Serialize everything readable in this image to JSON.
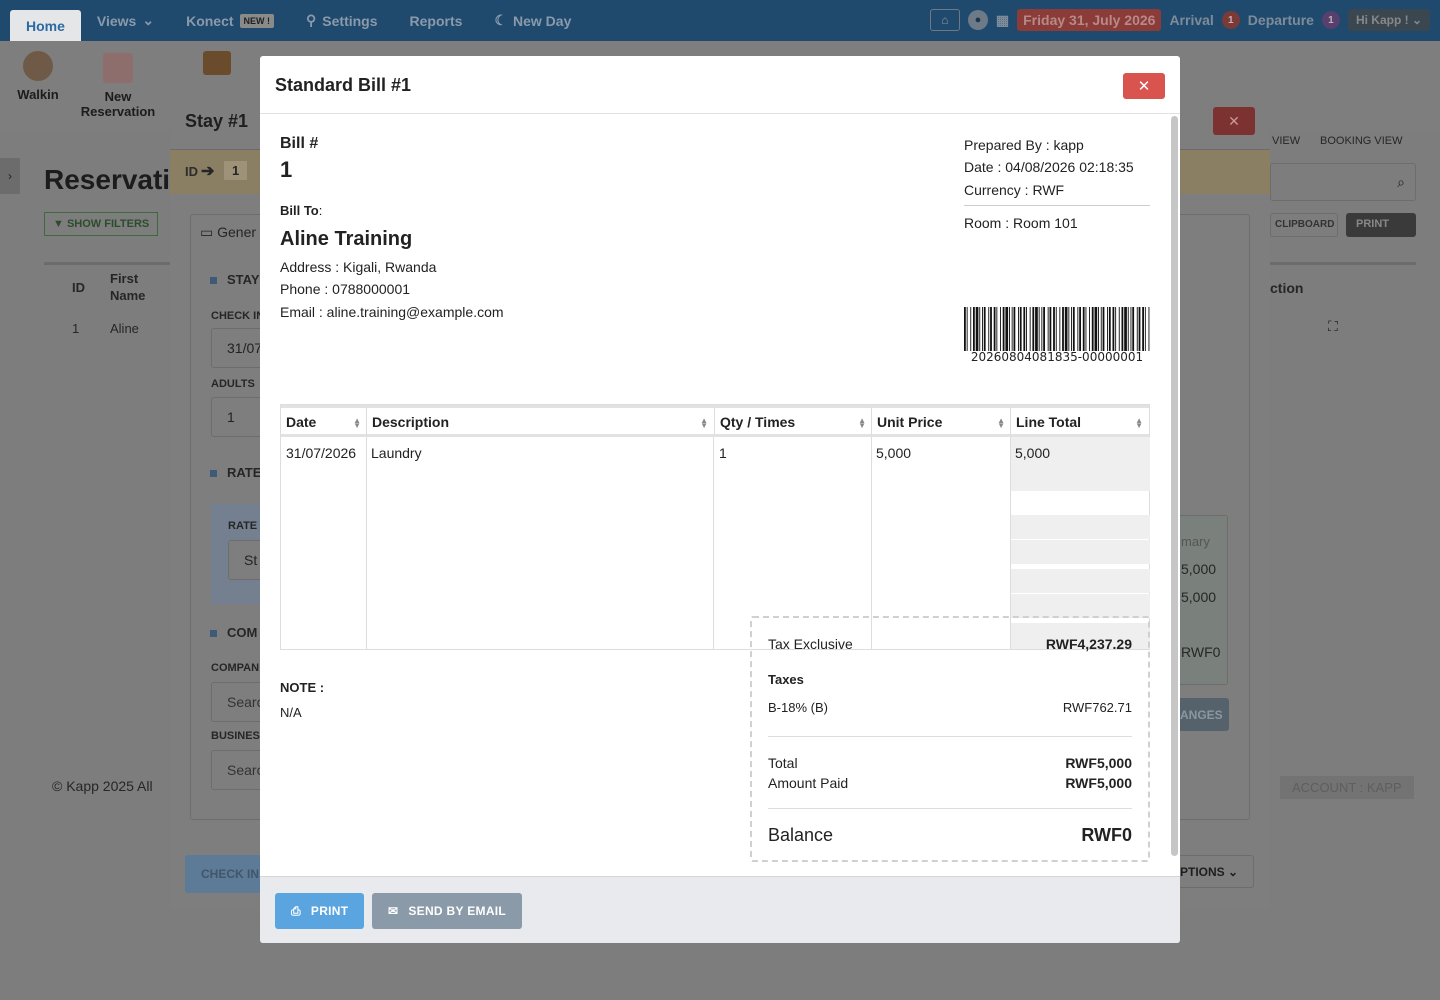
{
  "nav": {
    "tabs": [
      {
        "label": "Home"
      },
      {
        "label": "Views"
      },
      {
        "label": "Konect"
      },
      {
        "label": "Settings"
      },
      {
        "label": "Reports"
      },
      {
        "label": "New Day"
      }
    ],
    "konect_badge": "NEW !",
    "date": "Friday 31, July 2026",
    "arrival_label": "Arrival",
    "arrival_count": "1",
    "departure_label": "Departure",
    "departure_count": "1",
    "user": "Hi Kapp !"
  },
  "toolbar": {
    "walkin": "Walkin",
    "new_reservation_1": "New",
    "new_reservation_2": "Reservation"
  },
  "background": {
    "page_title": "Reservati",
    "show_filters": "SHOW FILTERS",
    "col_id": "ID",
    "col_first": "First",
    "col_name": "Name",
    "row_id": "1",
    "row_name": "Aline",
    "footer": "© Kapp 2025 All",
    "view": "VIEW",
    "booking_view": "BOOKING VIEW",
    "clipboard": "CLIPBOARD",
    "print": "PRINT",
    "action": "ction",
    "account": "ACCOUNT : KAPP"
  },
  "stay": {
    "title": "Stay #1",
    "id_label": "ID",
    "id_value": "1",
    "general_tab": "Gener",
    "stay_section": "STAY",
    "check_in_label": "CHECK IN",
    "check_in_value": "31/07",
    "adults_label": "ADULTS",
    "adults_value": "1",
    "rate_section": "RATE",
    "rate_label": "RATE",
    "rate_value": "St",
    "comp_section": "COM",
    "company_label": "COMPAN",
    "company_placeholder": "Searc",
    "business_label": "BUSINES",
    "business_placeholder": "Searc",
    "check_in_btn": "CHECK IN",
    "summary_label": "mary",
    "summary_v1": "5,000",
    "summary_v2": "5,000",
    "summary_v3": "RWF0",
    "changes_btn": "ANGES",
    "options_btn": "PTIONS"
  },
  "bill": {
    "title": "Standard Bill #1",
    "bill_no_label": "Bill #",
    "bill_no": "1",
    "prepared_by": "Prepared By : kapp",
    "date": "Date : 04/08/2026 02:18:35",
    "currency": "Currency : RWF",
    "room": "Room : Room 101",
    "barcode_text": "20260804081835-00000001",
    "bill_to_label": "Bill To",
    "bill_to_colon": ":",
    "customer_name": "Aline Training",
    "address": "Address : Kigali, Rwanda",
    "phone": "Phone : 0788000001",
    "email": "Email : aline.training@example.com",
    "table": {
      "headers": [
        "Date",
        "Description",
        "Qty / Times",
        "Unit Price",
        "Line Total"
      ],
      "rows": [
        [
          "31/07/2026",
          "Laundry",
          "1",
          "5,000",
          "5,000"
        ]
      ]
    },
    "note_label": "NOTE :",
    "note_value": "N/A",
    "summary": {
      "tax_exclusive_label": "Tax Exclusive",
      "tax_exclusive_value": "RWF4,237.29",
      "taxes_label": "Taxes",
      "tax_line_label": "B-18% (B)",
      "tax_line_value": "RWF762.71",
      "total_label": "Total",
      "total_value": "RWF5,000",
      "paid_label": "Amount Paid",
      "paid_value": "RWF5,000",
      "balance_label": "Balance",
      "balance_value": "RWF0"
    },
    "print_btn": "PRINT",
    "email_btn": "SEND BY EMAIL"
  },
  "colors": {
    "close_red": "#d9534f",
    "print_blue": "#5aa5e0",
    "email_gray": "#8a9aa8",
    "nav_blue": "#2b6aa2"
  }
}
